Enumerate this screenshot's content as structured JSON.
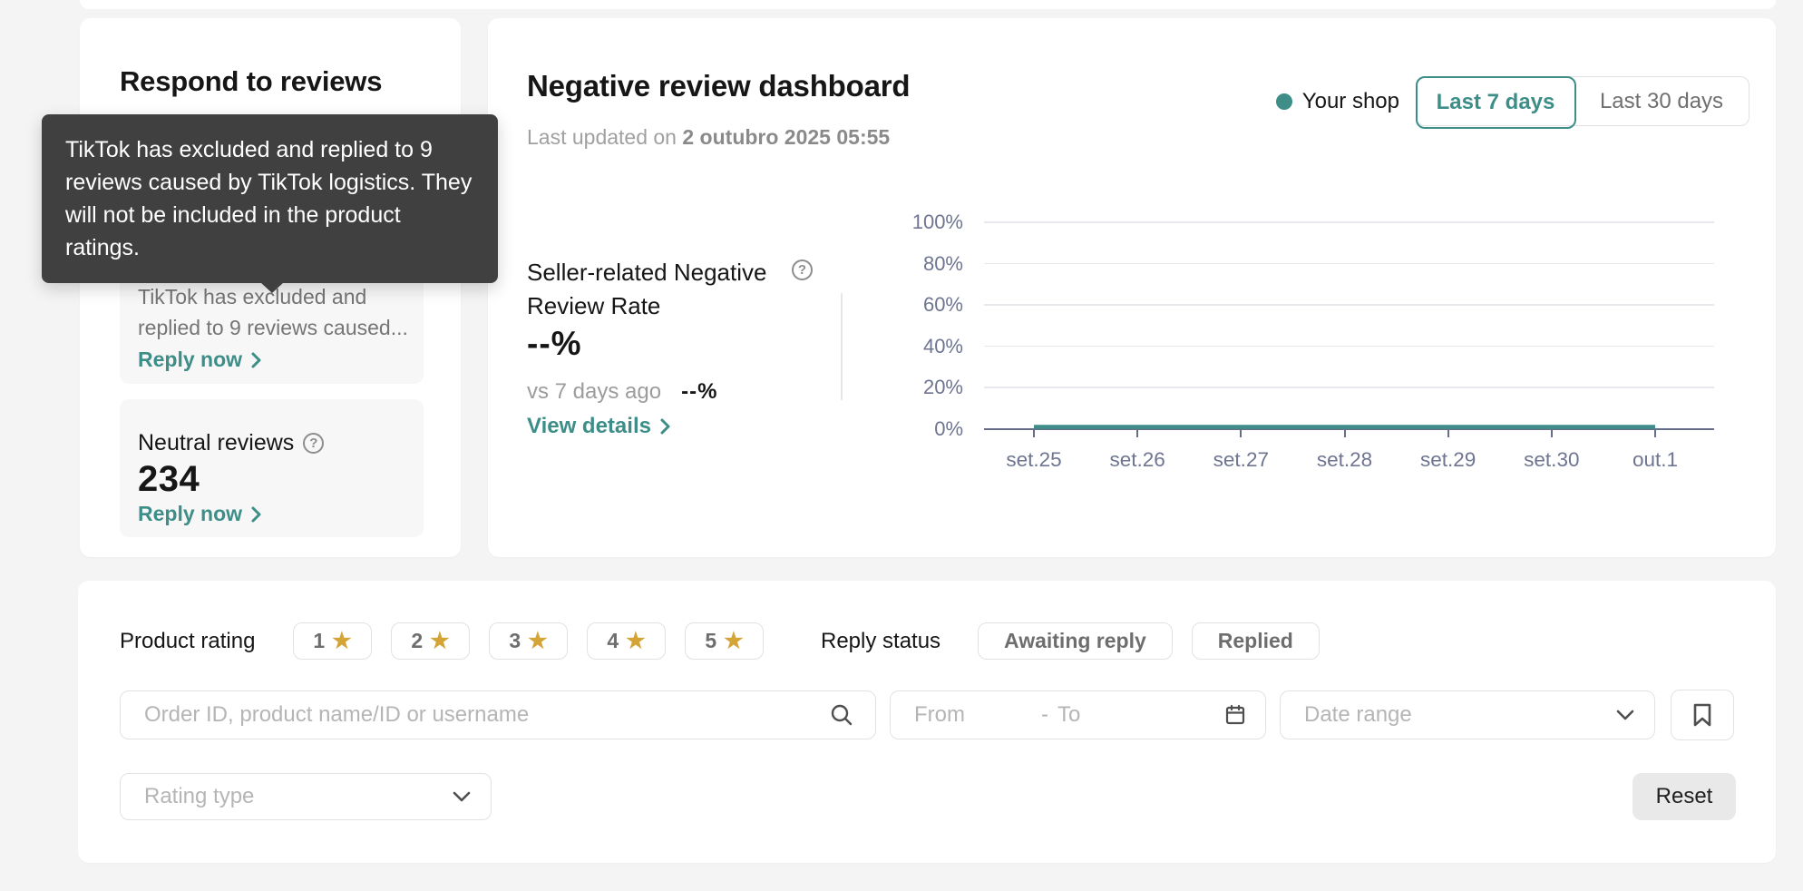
{
  "respond_card": {
    "title": "Respond to reviews",
    "excluded_card": {
      "text": "TikTok has excluded and replied to 9 reviews caused...",
      "link_label": "Reply now"
    },
    "neutral_card": {
      "label": "Neutral reviews",
      "count": "234",
      "link_label": "Reply now"
    }
  },
  "tooltip": {
    "text": "TikTok has excluded and replied to 9 reviews caused by TikTok logistics. They will not be included in the product ratings."
  },
  "dashboard": {
    "title": "Negative review dashboard",
    "last_updated_label": "Last updated on ",
    "last_updated_value": "2 outubro 2025 05:55",
    "legend_label": "Your shop",
    "range_buttons": {
      "0": "Last 7 days",
      "1": "Last 30 days"
    },
    "selected_range": "Last 7 days",
    "metric": {
      "label": "Seller-related Negative Review Rate",
      "value": "--%",
      "compare_label": "vs 7 days ago",
      "compare_value": "--%",
      "link_label": "View details"
    }
  },
  "chart_data": {
    "type": "line",
    "title": "Seller-related Negative Review Rate over time",
    "x": [
      "set.25",
      "set.26",
      "set.27",
      "set.28",
      "set.29",
      "set.30",
      "out.1"
    ],
    "series": [
      {
        "name": "Your shop",
        "color": "#3d8e88",
        "values": [
          0,
          0,
          0,
          0,
          0,
          0,
          0
        ]
      }
    ],
    "ylim": [
      0,
      100
    ],
    "yticks": [
      0,
      20,
      40,
      60,
      80,
      100
    ],
    "ytick_suffix": "%",
    "grid": true,
    "legend_position": "top-right"
  },
  "filters": {
    "product_rating_label": "Product rating",
    "rating_options": {
      "0": "1",
      "1": "2",
      "2": "3",
      "3": "4",
      "4": "5"
    },
    "reply_status_label": "Reply status",
    "reply_status_options": {
      "0": "Awaiting reply",
      "1": "Replied"
    },
    "search_placeholder": "Order ID, product name/ID or username",
    "date_from_placeholder": "From",
    "date_separator": "-",
    "date_to_placeholder": "To",
    "date_range_placeholder": "Date range",
    "rating_type_placeholder": "Rating type",
    "reset_label": "Reset"
  },
  "icons": {
    "star": "★",
    "question": "?"
  },
  "colors": {
    "accent_teal": "#3d8e88",
    "star_gold": "#d5a437",
    "tooltip_bg": "#404040",
    "axis_slate": "#666d89",
    "page_bg": "#f4f4f4"
  }
}
